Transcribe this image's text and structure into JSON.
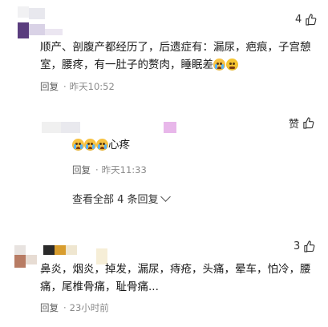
{
  "colors": {
    "text": "#1a1a1a",
    "meta": "#8a8a8a",
    "accent_purple": "#d9a8f2"
  },
  "comment1": {
    "like_count": "4",
    "text_line1": "顺产、剖腹产都经历了，后遗症有：漏尿，疤痕，子宫憩",
    "text_line2": "室，腰疼，有一肚子的赘肉，睡眠差",
    "reply_label": "回复",
    "dot": "·",
    "time": "昨天10:52"
  },
  "reply1": {
    "like_label": "赞",
    "text": "心疼",
    "reply_label": "回复",
    "dot": "·",
    "time": "昨天11:33"
  },
  "view_all": {
    "label": "查看全部 4 条回复"
  },
  "comment2": {
    "like_count": "3",
    "text_line1": "鼻炎，烟炎，掉发，漏尿，痔疮，头痛，晕车，怕冷，腰",
    "text_line2": "痛，尾椎骨痛，耻骨痛...",
    "reply_label": "回复",
    "dot": "·",
    "time": "23小时前"
  }
}
